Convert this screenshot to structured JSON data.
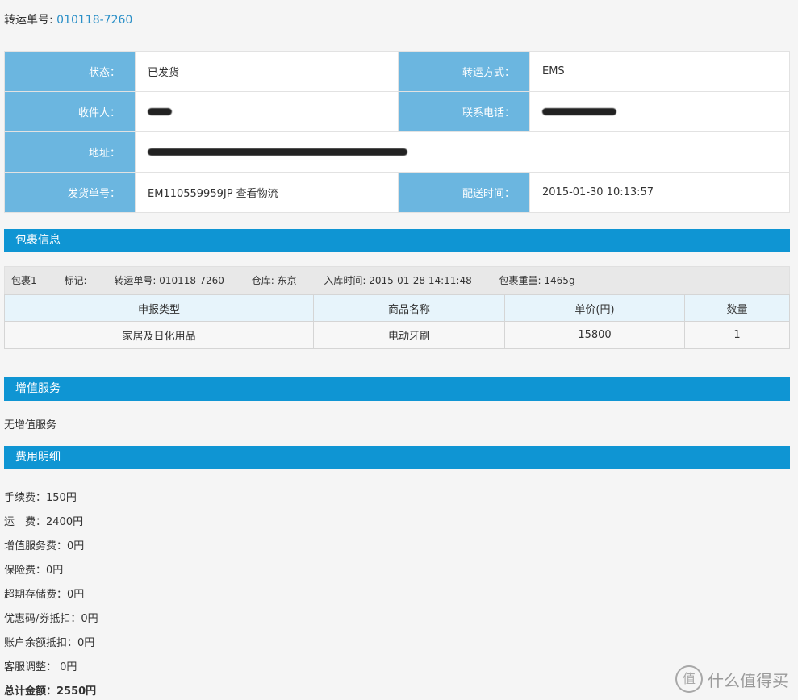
{
  "header": {
    "label": "转运单号: ",
    "order_no": "010118-7260"
  },
  "info": {
    "status_label": "状态：",
    "status_value": "已发货",
    "method_label": "转运方式：",
    "method_value": "EMS",
    "recipient_label": "收件人：",
    "phone_label": "联系电话：",
    "address_label": "地址：",
    "ship_no_label": "发货单号：",
    "ship_no_value": "EM110559959JP 查看物流",
    "ship_time_label": "配送时间：",
    "ship_time_value": "2015-01-30 10:13:57"
  },
  "package_section": {
    "title": "包裹信息",
    "meta": {
      "pkg": "包裹1",
      "mark": "标记:",
      "order": "转运单号: 010118-7260",
      "warehouse": "仓库: 东京",
      "inbound": "入库时间: 2015-01-28 14:11:48",
      "weight": "包裹重量: 1465g"
    },
    "columns": [
      "申报类型",
      "商品名称",
      "单价(円)",
      "数量"
    ],
    "rows": [
      [
        "家居及日化用品",
        "电动牙刷",
        "15800",
        "1"
      ]
    ]
  },
  "value_added": {
    "title": "增值服务",
    "text": "无增值服务"
  },
  "fees": {
    "title": "费用明细",
    "items": [
      "手续费：150円",
      "运　费：2400円",
      "增值服务费：0円",
      "保险费：0円",
      "超期存储费：0円",
      "优惠码/券抵扣：0円",
      "账户余额抵扣：0円",
      "客服调整： 0円"
    ],
    "total": "总计金额：2550円"
  },
  "watermark": {
    "mark": "值",
    "text": "什么值得买"
  }
}
